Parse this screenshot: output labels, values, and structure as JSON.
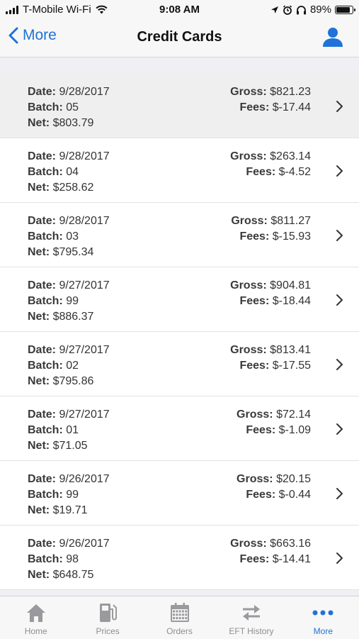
{
  "status_bar": {
    "carrier": "T-Mobile Wi-Fi",
    "time": "9:08 AM",
    "battery": "89%",
    "battery_level": 0.89
  },
  "nav": {
    "back_label": "More",
    "title": "Credit Cards",
    "profile_icon": "person-icon"
  },
  "labels": {
    "date": "Date:",
    "batch": "Batch:",
    "net": "Net:",
    "gross": "Gross:",
    "fees": "Fees:"
  },
  "rows": [
    {
      "date": "9/28/2017",
      "batch": "05",
      "net": "$803.79",
      "gross": "$821.23",
      "fees": "$-17.44"
    },
    {
      "date": "9/28/2017",
      "batch": "04",
      "net": "$258.62",
      "gross": "$263.14",
      "fees": "$-4.52"
    },
    {
      "date": "9/28/2017",
      "batch": "03",
      "net": "$795.34",
      "gross": "$811.27",
      "fees": "$-15.93"
    },
    {
      "date": "9/27/2017",
      "batch": "99",
      "net": "$886.37",
      "gross": "$904.81",
      "fees": "$-18.44"
    },
    {
      "date": "9/27/2017",
      "batch": "02",
      "net": "$795.86",
      "gross": "$813.41",
      "fees": "$-17.55"
    },
    {
      "date": "9/27/2017",
      "batch": "01",
      "net": "$71.05",
      "gross": "$72.14",
      "fees": "$-1.09"
    },
    {
      "date": "9/26/2017",
      "batch": "99",
      "net": "$19.71",
      "gross": "$20.15",
      "fees": "$-0.44"
    },
    {
      "date": "9/26/2017",
      "batch": "98",
      "net": "$648.75",
      "gross": "$663.16",
      "fees": "$-14.41"
    }
  ],
  "tabs": [
    {
      "label": "Home",
      "icon": "house-icon",
      "active": false
    },
    {
      "label": "Prices",
      "icon": "fuel-pump-icon",
      "active": false
    },
    {
      "label": "Orders",
      "icon": "calendar-icon",
      "active": false
    },
    {
      "label": "EFT History",
      "icon": "transfer-arrows-icon",
      "active": false
    },
    {
      "label": "More",
      "icon": "more-dots-icon",
      "active": true
    }
  ],
  "colors": {
    "accent": "#1f72d8",
    "inactive_tab": "#8e8e93"
  }
}
